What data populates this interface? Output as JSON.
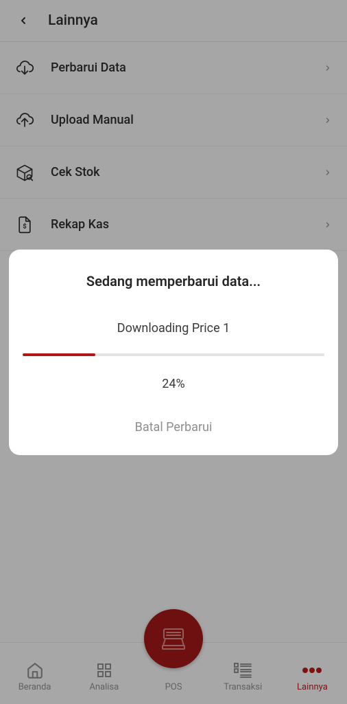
{
  "header": {
    "title": "Lainnya"
  },
  "menu": {
    "items": [
      {
        "label": "Perbarui Data",
        "icon": "cloud-download-icon"
      },
      {
        "label": "Upload Manual",
        "icon": "cloud-upload-icon"
      },
      {
        "label": "Cek Stok",
        "icon": "box-search-icon"
      },
      {
        "label": "Rekap Kas",
        "icon": "file-money-icon"
      }
    ]
  },
  "modal": {
    "title": "Sedang memperbarui data...",
    "status": "Downloading Price 1",
    "percent_value": 24,
    "percent_text": "24%",
    "cancel": "Batal Perbarui"
  },
  "nav": {
    "items": [
      {
        "label": "Beranda",
        "key": "home"
      },
      {
        "label": "Analisa",
        "key": "analisa"
      },
      {
        "label": "POS",
        "key": "pos"
      },
      {
        "label": "Transaksi",
        "key": "transaksi"
      },
      {
        "label": "Lainnya",
        "key": "lainnya"
      }
    ],
    "active": "lainnya"
  },
  "colors": {
    "accent": "#b01717",
    "text": "#2e2e2e",
    "muted": "#8f8f8f"
  }
}
